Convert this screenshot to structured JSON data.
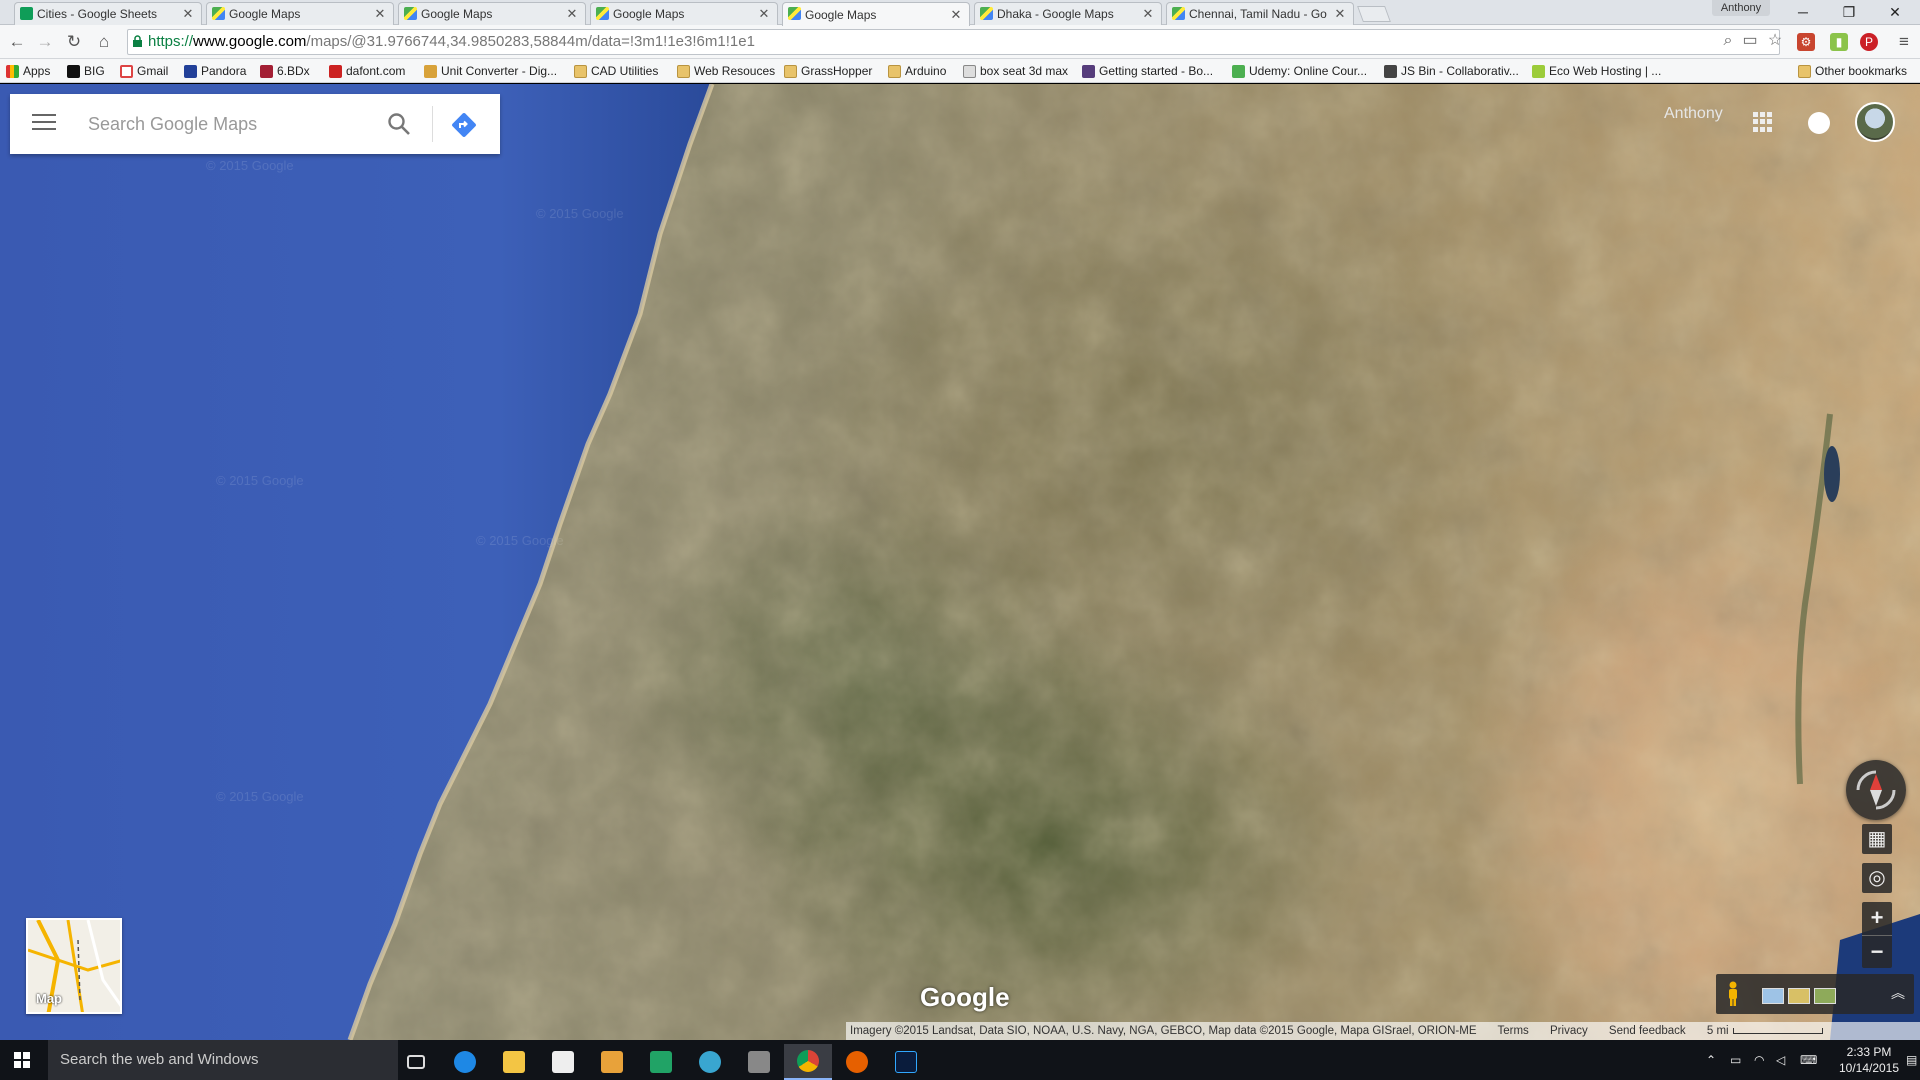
{
  "browser": {
    "tabs": [
      {
        "title": "Cities - Google Sheets",
        "icon": "sheets-icon"
      },
      {
        "title": "Google Maps",
        "icon": "maps-icon"
      },
      {
        "title": "Google Maps",
        "icon": "maps-icon"
      },
      {
        "title": "Google Maps",
        "icon": "maps-icon"
      },
      {
        "title": "Google Maps",
        "icon": "maps-icon",
        "active": true
      },
      {
        "title": "Dhaka - Google Maps",
        "icon": "maps-icon"
      },
      {
        "title": "Chennai, Tamil Nadu - Go",
        "icon": "maps-icon"
      }
    ],
    "profile_name": "Anthony",
    "url": {
      "scheme": "https://",
      "host": "www.google.com",
      "path": "/maps/@31.9766744,34.9850283,58844m/data=!3m1!1e3!6m1!1e1"
    },
    "bookmarks": [
      {
        "label": "Apps",
        "icon": "apps-icon"
      },
      {
        "label": "BIG",
        "icon": "big-icon"
      },
      {
        "label": "Gmail",
        "icon": "gmail-icon"
      },
      {
        "label": "Pandora",
        "icon": "pandora-icon"
      },
      {
        "label": "6.BDx",
        "icon": "edx-icon"
      },
      {
        "label": "dafont.com",
        "icon": "dafont-icon"
      },
      {
        "label": "Unit Converter - Dig...",
        "icon": "converter-icon"
      },
      {
        "label": "CAD Utilities",
        "icon": "folder-icon"
      },
      {
        "label": "Web Resouces",
        "icon": "folder-icon"
      },
      {
        "label": "GrassHopper",
        "icon": "folder-icon"
      },
      {
        "label": "Arduino",
        "icon": "folder-icon"
      },
      {
        "label": "box seat 3d max",
        "icon": "page-icon"
      },
      {
        "label": "Getting started - Bo...",
        "icon": "bootstrap-icon"
      },
      {
        "label": "Udemy: Online Cour...",
        "icon": "udemy-icon"
      },
      {
        "label": "JS Bin - Collaborativ...",
        "icon": "jsbin-icon"
      },
      {
        "label": "Eco Web Hosting | ...",
        "icon": "eco-icon"
      }
    ],
    "other_bookmarks": "Other bookmarks"
  },
  "maps": {
    "search_placeholder": "Search Google Maps",
    "account_name": "Anthony",
    "watermark": "© 2015 Google",
    "minimap_label": "Map",
    "google_logo": "Google",
    "attribution": "Imagery ©2015 Landsat, Data SIO, NOAA, U.S. Navy, NGA, GEBCO, Map data ©2015 Google, Mapa GISrael, ORION-ME",
    "terms": "Terms",
    "privacy": "Privacy",
    "send_feedback": "Send feedback",
    "scale": "5 mi"
  },
  "taskbar": {
    "search_text": "Search the web and Windows",
    "time": "2:33 PM",
    "date": "10/14/2015"
  },
  "colors": {
    "sea": "#3d5fb4",
    "chrome_accent": "#4285f4"
  }
}
